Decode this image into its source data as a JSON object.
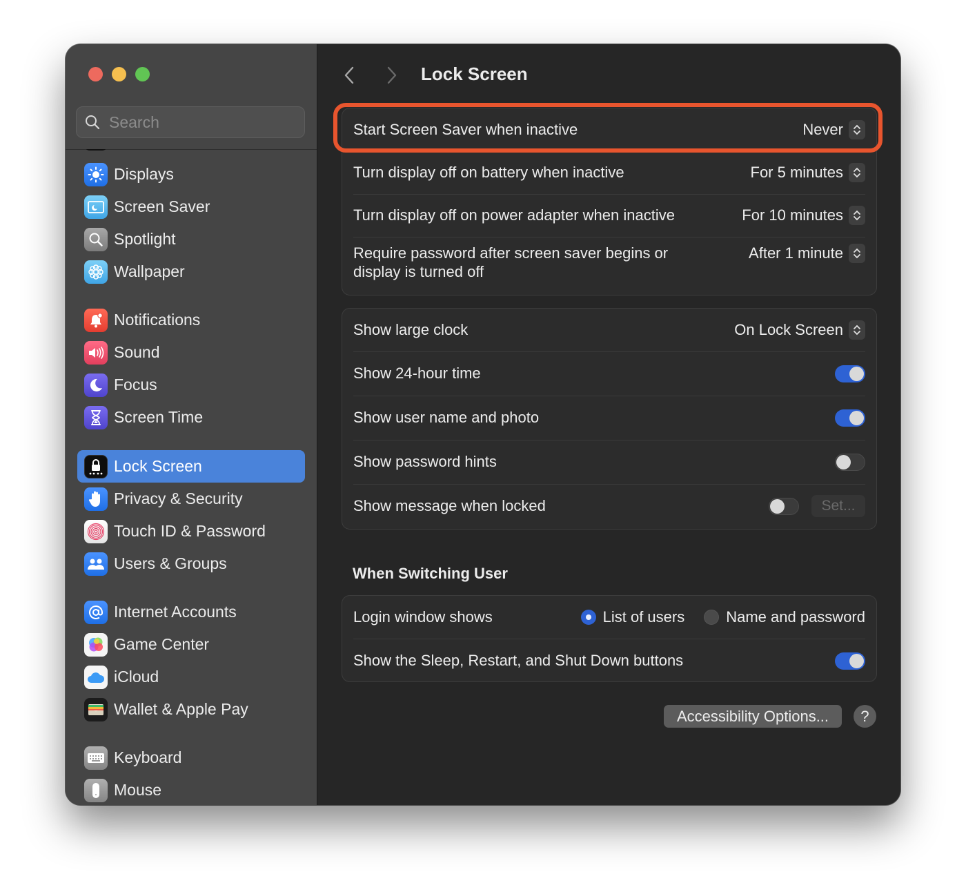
{
  "window": {
    "traffic_lights": [
      "close",
      "minimize",
      "zoom"
    ]
  },
  "sidebar": {
    "search": {
      "placeholder": "Search",
      "value": ""
    },
    "items": [
      {
        "label": "Displays",
        "icon": "sun-icon",
        "color": "#2f7cf6"
      },
      {
        "label": "Screen Saver",
        "icon": "screen-saver-icon",
        "color": "#4fb6ee"
      },
      {
        "label": "Spotlight",
        "icon": "magnifier-icon",
        "color": "#8e8e8e"
      },
      {
        "label": "Wallpaper",
        "icon": "flower-icon",
        "color": "#4fb6ee"
      },
      {
        "label": "Notifications",
        "icon": "bell-icon",
        "color": "#e9503f"
      },
      {
        "label": "Sound",
        "icon": "speaker-icon",
        "color": "#e84a66"
      },
      {
        "label": "Focus",
        "icon": "moon-icon",
        "color": "#5b50d6"
      },
      {
        "label": "Screen Time",
        "icon": "hourglass-icon",
        "color": "#5b50d6"
      },
      {
        "label": "Lock Screen",
        "icon": "lock-icon",
        "color": "#111111",
        "active": true
      },
      {
        "label": "Privacy & Security",
        "icon": "hand-icon",
        "color": "#2f7cf6"
      },
      {
        "label": "Touch ID & Password",
        "icon": "fingerprint-icon",
        "color": "#f2f2f2"
      },
      {
        "label": "Users & Groups",
        "icon": "users-icon",
        "color": "#2f7cf6"
      },
      {
        "label": "Internet Accounts",
        "icon": "at-icon",
        "color": "#2f7cf6"
      },
      {
        "label": "Game Center",
        "icon": "game-center-icon",
        "color": "#f2f2f2"
      },
      {
        "label": "iCloud",
        "icon": "cloud-icon",
        "color": "#f2f2f2"
      },
      {
        "label": "Wallet & Apple Pay",
        "icon": "wallet-icon",
        "color": "#1a1a1a"
      },
      {
        "label": "Keyboard",
        "icon": "keyboard-icon",
        "color": "#9a9a9a"
      },
      {
        "label": "Mouse",
        "icon": "mouse-icon",
        "color": "#9a9a9a"
      }
    ]
  },
  "header": {
    "title": "Lock Screen"
  },
  "group1": {
    "rows": [
      {
        "label": "Start Screen Saver when inactive",
        "value": "Never"
      },
      {
        "label": "Turn display off on battery when inactive",
        "value": "For 5 minutes"
      },
      {
        "label": "Turn display off on power adapter when inactive",
        "value": "For 10 minutes"
      },
      {
        "label": "Require password after screen saver begins or display is turned off",
        "value": "After 1 minute"
      }
    ]
  },
  "group2": {
    "clock": {
      "label": "Show large clock",
      "value": "On Lock Screen"
    },
    "toggles": [
      {
        "label": "Show 24-hour time",
        "on": true
      },
      {
        "label": "Show user name and photo",
        "on": true
      },
      {
        "label": "Show password hints",
        "on": false
      },
      {
        "label": "Show message when locked",
        "on": false
      }
    ],
    "set_button": "Set..."
  },
  "switching": {
    "title": "When Switching User",
    "login_label": "Login window shows",
    "options": [
      {
        "label": "List of users",
        "selected": true
      },
      {
        "label": "Name and password",
        "selected": false
      }
    ],
    "buttons_row": {
      "label": "Show the Sleep, Restart, and Shut Down buttons",
      "on": true
    }
  },
  "footer": {
    "accessibility_button": "Accessibility Options...",
    "help_button": "?"
  },
  "colors": {
    "accent": "#2e62d4",
    "selection": "#4a83da",
    "highlight_annotation": "#e8552e"
  }
}
